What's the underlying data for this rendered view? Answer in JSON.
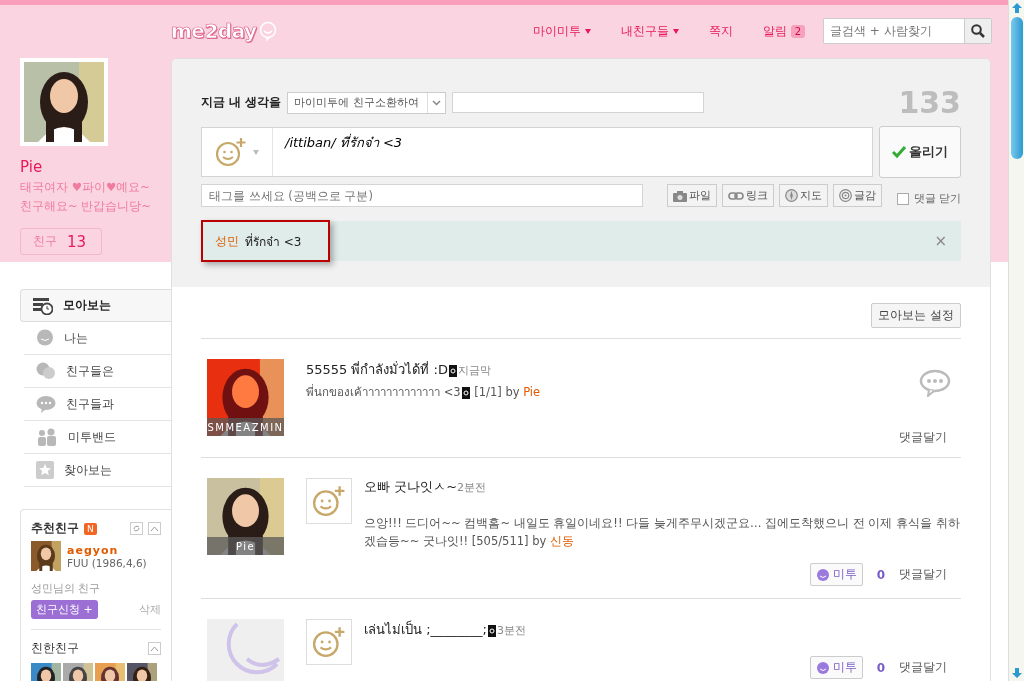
{
  "header": {
    "logo": "me2day",
    "nav": [
      {
        "label": "마이미투",
        "dropdown": true
      },
      {
        "label": "내친구들",
        "dropdown": true
      },
      {
        "label": "쪽지",
        "dropdown": false
      },
      {
        "label": "알림",
        "dropdown": false,
        "badge": "2"
      }
    ],
    "search": {
      "placeholder": "글검색 + 사람찾기"
    }
  },
  "profile": {
    "name": "Pie",
    "bio": [
      "태국여자 ♥파이♥예요~",
      "친구해요~ 반갑습니당~"
    ],
    "friends_label": "친구",
    "friends_count": "13"
  },
  "menu": [
    {
      "label": "모아보는",
      "selected": true
    },
    {
      "label": "나는",
      "selected": false
    },
    {
      "label": "친구들은",
      "selected": false
    },
    {
      "label": "친구들과",
      "selected": false
    },
    {
      "label": "미투밴드",
      "selected": false
    },
    {
      "label": "찾아보는",
      "selected": false
    }
  ],
  "recommend": {
    "title": "추천친구",
    "badge": "N",
    "friend": {
      "name": "aegyon",
      "info": "FUU (1986,4,6)",
      "relation": "성민님의 친구"
    },
    "add_button": "친구신청 +",
    "delete": "삭제"
  },
  "close_friends": {
    "title": "친한친구"
  },
  "compose": {
    "label": "지금 내 생각을",
    "topic": "마이미투에 친구소환하여",
    "counter": "133",
    "text": "/ittiban/ ที่รักจ๋า <3",
    "post_button": "올리기",
    "tag_placeholder": "태그를 쓰세요 (공백으로 구분)",
    "tools": [
      {
        "label": "파일"
      },
      {
        "label": "링크"
      },
      {
        "label": "지도"
      },
      {
        "label": "글감"
      }
    ],
    "close_comments": {
      "label": "댓글 닫기",
      "checked": false
    },
    "notice": {
      "name": "성민",
      "text": "ที่รักจ๋า <3",
      "close": "×"
    }
  },
  "feed": {
    "settings_button": "모아보는 설정",
    "posts": [
      {
        "caption": "SMMEAZMIN",
        "emoticon": false,
        "title": "55555 พี่กำลังมั่วได้ที่ :D",
        "title_mark": true,
        "time": "지금막",
        "body": "พี่นกของเค้าาาาาาาาาาาาา <3",
        "body_mark": true,
        "counter": "[1/1]",
        "by": "by",
        "author": "Pie",
        "comment_bubble": true,
        "comment": "댓글달기"
      },
      {
        "caption": "Pie",
        "emoticon": true,
        "title": "오빠 굿나잇ㅅ~",
        "title_mark": false,
        "time": "2분전",
        "body": "으앙!!! 드디어~~ 컴백홈~ 내일도 휴일이네요!! 다들 늦게주무시겠군요… 집에도착했으니 전 이제 휴식을 취하겠습등~~ 굿나잇!!",
        "body_mark": false,
        "by": "by",
        "author": "신동",
        "counter": "[505/511]",
        "comment_bubble": false,
        "metoo": "미투",
        "metoo_count": "0",
        "comment": "댓글달기"
      },
      {
        "kind": "default",
        "emoticon": true,
        "title": "เล่นไม่เป็น ;________;",
        "title_mark": true,
        "time": "3분전",
        "body_mark": false,
        "comment_bubble": false,
        "metoo": "미투",
        "metoo_count": "0",
        "comment": "댓글달기"
      }
    ]
  }
}
